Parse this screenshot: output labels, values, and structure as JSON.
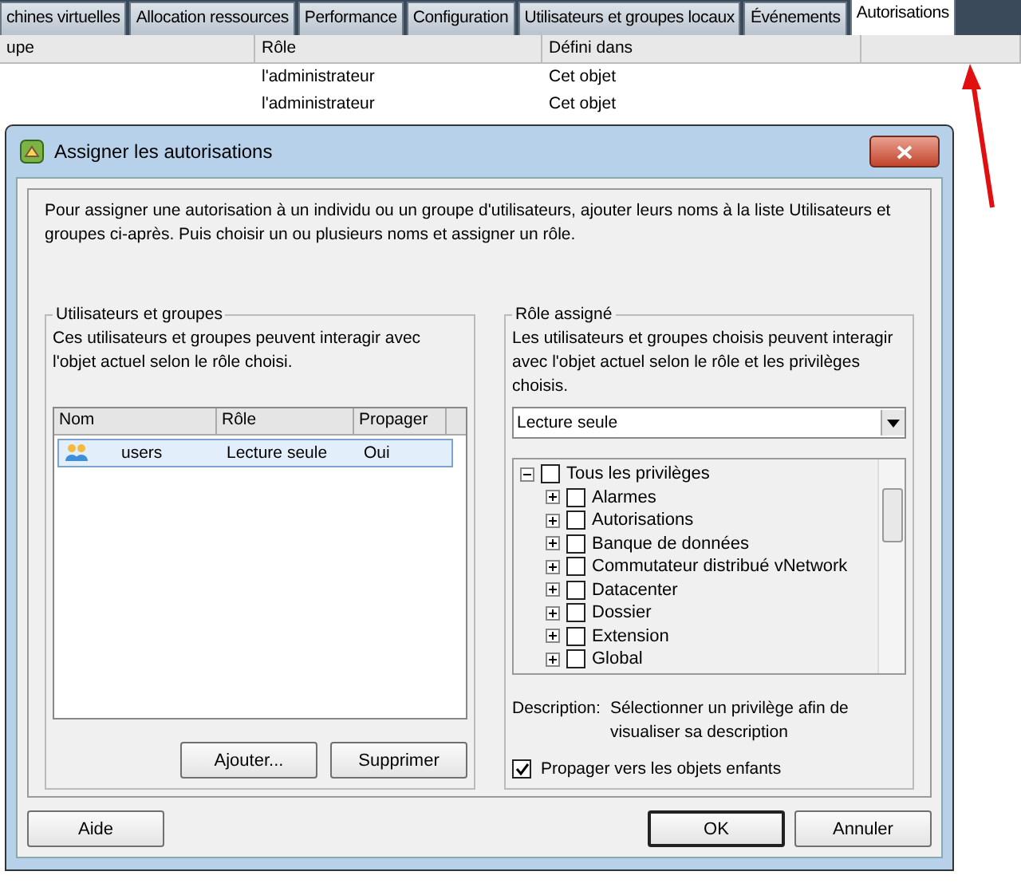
{
  "tabs": [
    {
      "label": "chines virtuelles",
      "selected": false
    },
    {
      "label": "Allocation ressources",
      "selected": false
    },
    {
      "label": "Performance",
      "selected": false
    },
    {
      "label": "Configuration",
      "selected": false
    },
    {
      "label": "Utilisateurs et groupes locaux",
      "selected": false
    },
    {
      "label": "Événements",
      "selected": false
    },
    {
      "label": "Autorisations",
      "selected": true
    }
  ],
  "table": {
    "columns": [
      "upe",
      "Rôle",
      "Défini dans"
    ],
    "rows": [
      {
        "role": "l'administrateur",
        "defined_in": "Cet objet"
      },
      {
        "role": "l'administrateur",
        "defined_in": "Cet objet"
      }
    ]
  },
  "dialog": {
    "title": "Assigner les autorisations",
    "intro": "Pour assigner une autorisation à un individu ou un groupe d'utilisateurs, ajouter leurs noms à la liste Utilisateurs et groupes ci-après. Puis choisir un ou plusieurs noms et assigner un rôle.",
    "users_group": {
      "title": "Utilisateurs et groupes",
      "text": "Ces utilisateurs et groupes peuvent interagir avec l'objet actuel selon le rôle choisi.",
      "columns": [
        "Nom",
        "Rôle",
        "Propager"
      ],
      "rows": [
        {
          "name": "users",
          "role": "Lecture seule",
          "propagate": "Oui",
          "selected": true
        }
      ],
      "buttons": [
        "Ajouter...",
        "Supprimer"
      ]
    },
    "role_group": {
      "title": "Rôle assigné",
      "text": "Les utilisateurs et groupes choisis peuvent interagir avec l'objet actuel selon le rôle et les privilèges choisis.",
      "role": "Lecture seule",
      "privileges": [
        {
          "label": "Tous les privilèges",
          "checked": false,
          "expanded": true,
          "children": [
            {
              "label": "Alarmes",
              "checked": false,
              "expanded": false
            },
            {
              "label": "Autorisations",
              "checked": false,
              "expanded": false
            },
            {
              "label": "Banque de données",
              "checked": false,
              "expanded": false
            },
            {
              "label": "Commutateur distribué vNetwork",
              "checked": false,
              "expanded": false
            },
            {
              "label": "Datacenter",
              "checked": false,
              "expanded": false
            },
            {
              "label": "Dossier",
              "checked": false,
              "expanded": false
            },
            {
              "label": "Extension",
              "checked": false,
              "expanded": false
            },
            {
              "label": "Global",
              "checked": false,
              "expanded": false
            }
          ]
        }
      ],
      "description_label": "Description:",
      "description": "Sélectionner un privilège afin de visualiser sa description",
      "propagate": {
        "label": "Propager vers les objets enfants",
        "checked": true
      }
    },
    "buttons": [
      {
        "label": "Aide",
        "default": false
      },
      {
        "label": "OK",
        "default": true
      },
      {
        "label": "Annuler",
        "default": false
      }
    ]
  }
}
